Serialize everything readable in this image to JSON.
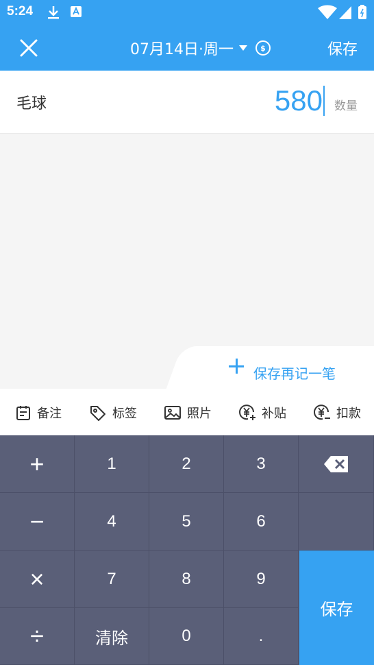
{
  "status": {
    "time": "5:24"
  },
  "header": {
    "date": "07月14日·周一",
    "save": "保存",
    "coin_symbol": "$"
  },
  "item": {
    "name": "毛球",
    "amount": "580",
    "unit": "数量"
  },
  "save_again": "保存再记一笔",
  "toolbar": [
    {
      "label": "备注",
      "icon": "note-icon"
    },
    {
      "label": "标签",
      "icon": "tag-icon"
    },
    {
      "label": "照片",
      "icon": "photo-icon"
    },
    {
      "label": "补贴",
      "icon": "subsidy-icon"
    },
    {
      "label": "扣款",
      "icon": "deduct-icon"
    }
  ],
  "keys": {
    "plus": "+",
    "minus": "−",
    "times": "×",
    "divide": "÷",
    "k1": "1",
    "k2": "2",
    "k3": "3",
    "k4": "4",
    "k5": "5",
    "k6": "6",
    "k7": "7",
    "k8": "8",
    "k9": "9",
    "k0": "0",
    "dot": ".",
    "clear": "清除",
    "save": "保存"
  },
  "colors": {
    "accent": "#36a2f2",
    "keypad": "#5a5f78"
  }
}
